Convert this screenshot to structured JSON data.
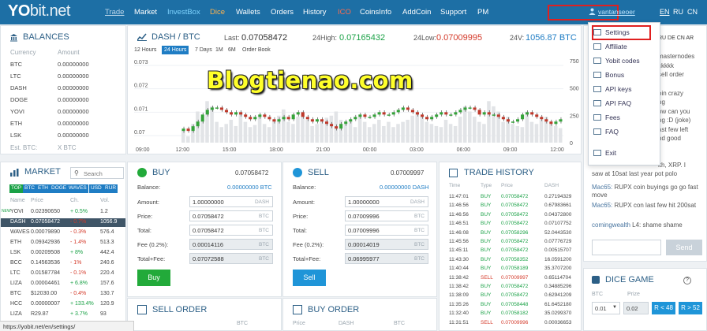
{
  "header": {
    "logo_main": "YO",
    "logo_rest": "bit.net",
    "nav": [
      "Trade",
      "Market",
      "InvestBox",
      "Dice",
      "Wallets",
      "Orders",
      "History",
      "ICO",
      "CoinsInfo",
      "AddCoin",
      "Support",
      "PM"
    ],
    "username": "vantanseoer",
    "langs": [
      "EN",
      "RU",
      "CN"
    ]
  },
  "balances": {
    "title": "BALANCES",
    "col_currency": "Currency",
    "col_amount": "Amount",
    "rows": [
      {
        "c": "BTC",
        "a": "0.00000000"
      },
      {
        "c": "LTC",
        "a": "0.00000000"
      },
      {
        "c": "DASH",
        "a": "0.00000000"
      },
      {
        "c": "DOGE",
        "a": "0.00000000"
      },
      {
        "c": "YOVI",
        "a": "0.00000000"
      },
      {
        "c": "ETH",
        "a": "0.00000000"
      },
      {
        "c": "LSK",
        "a": "0.00000000"
      }
    ],
    "est_label": "Est. BTC:",
    "est_value": "X BTC"
  },
  "market": {
    "title": "MARKET",
    "search_placeholder": "Search",
    "tabs": [
      "TOP",
      "BTC",
      "ETH",
      "DOGE",
      "WAVES",
      "USD",
      "RUR"
    ],
    "cols": [
      "Name",
      "Price",
      "Ch.",
      "Vol."
    ],
    "rows": [
      {
        "n": "YOVI",
        "p": "0.02390650",
        "ch": "+ 0.5%",
        "v": "1.2",
        "up": true
      },
      {
        "n": "DASH",
        "p": "0.07058472",
        "ch": "- 0.7%",
        "v": "1056.9",
        "up": false
      },
      {
        "n": "WAVES",
        "p": "0.00079890",
        "ch": "- 0.3%",
        "v": "576.4",
        "up": false
      },
      {
        "n": "ETH",
        "p": "0.09342936",
        "ch": "- 1.4%",
        "v": "513.3",
        "up": false
      },
      {
        "n": "LSK",
        "p": "0.00209508",
        "ch": "+ 8%",
        "v": "442.4",
        "up": true
      },
      {
        "n": "BCC",
        "p": "0.14563536",
        "ch": "- 1%",
        "v": "240.6",
        "up": false
      },
      {
        "n": "LTC",
        "p": "0.01587784",
        "ch": "- 0.1%",
        "v": "220.4",
        "up": false
      },
      {
        "n": "LIZA",
        "p": "0.00004461",
        "ch": "+ 6.8%",
        "v": "157.6",
        "up": true
      },
      {
        "n": "BTC",
        "p": "$12030.00",
        "ch": "- 0.4%",
        "v": "130.7",
        "up": false
      },
      {
        "n": "HCC",
        "p": "0.00000007",
        "ch": "+ 133.4%",
        "v": "120.9",
        "up": true
      },
      {
        "n": "LIZA",
        "p": "R29.87",
        "ch": "+ 3.7%",
        "v": "93",
        "up": true
      }
    ]
  },
  "chart": {
    "pair": "DASH / BTC",
    "last_label": "Last:",
    "last": "0.07058472",
    "high_label": "24High:",
    "high": "0.07165432",
    "low_label": "24Low:",
    "low": "0.07009995",
    "vol_label": "24V:",
    "vol": "1056.87 BTC",
    "ranges": [
      "12 Hours",
      "24 Hours",
      "7 Days",
      "1M",
      "6M",
      "Order Book"
    ],
    "active_range": "24 Hours"
  },
  "chart_data": {
    "type": "candlestick",
    "yticks": [
      "0.073",
      "0.072",
      "0.071",
      "0.07"
    ],
    "vol_ticks": [
      "750",
      "500",
      "250",
      "0"
    ],
    "xticks": [
      "09:00",
      "12:00",
      "15:00",
      "18:00",
      "21:00",
      "00:00",
      "03:00",
      "06:00",
      "09:00",
      "12:00"
    ],
    "ylim": [
      0.0697,
      0.0732
    ],
    "close": [
      0.0703,
      0.0702,
      0.0704,
      0.0706,
      0.0709,
      0.0711,
      0.0712,
      0.0712,
      0.0711,
      0.071,
      0.0709,
      0.071,
      0.0709,
      0.0708,
      0.0707,
      0.0708,
      0.0709,
      0.0708,
      0.0707,
      0.0706,
      0.0707,
      0.0708,
      0.0707,
      0.0709,
      0.071,
      0.0708,
      0.0707,
      0.0706,
      0.0707,
      0.0706,
      0.0705,
      0.0704,
      0.0703,
      0.0705,
      0.0706,
      0.0707,
      0.0708,
      0.0709,
      0.0708,
      0.0708,
      0.0709,
      0.071,
      0.0709,
      0.0709,
      0.071,
      0.0711,
      0.0712,
      0.0711,
      0.071,
      0.0709,
      0.0708,
      0.0707,
      0.0708,
      0.0709,
      0.071,
      0.0709,
      0.0709,
      0.071,
      0.0711,
      0.0712,
      0.0712,
      0.0711,
      0.0709,
      0.071,
      0.0709,
      0.0709,
      0.0708,
      0.0707,
      0.0706,
      0.0706,
      0.0707,
      0.0709,
      0.071,
      0.0709,
      0.0708,
      0.0707,
      0.0706,
      0.0705,
      0.0706,
      0.0707
    ],
    "volume": [
      120,
      60,
      180,
      300,
      250,
      400,
      350,
      200,
      150,
      180,
      220,
      160,
      300,
      200,
      150,
      170,
      260,
      180,
      150,
      220,
      260,
      320,
      200,
      180,
      250,
      300,
      220,
      160,
      180,
      220,
      240,
      260,
      300,
      220,
      180,
      200,
      150,
      250,
      200,
      150,
      180,
      220,
      160,
      200,
      150,
      180,
      200,
      220,
      260,
      300,
      250,
      200,
      180,
      160,
      150,
      220,
      180,
      160,
      250,
      350,
      300,
      250,
      200,
      180,
      400,
      350,
      300,
      200,
      250,
      180,
      160,
      150,
      300,
      200,
      180,
      220,
      250,
      180,
      160,
      140
    ]
  },
  "buy": {
    "title": "BUY",
    "top_price": "0.07058472",
    "balance_label": "Balance:",
    "balance": "0.00000000 BTC",
    "amount_label": "Amount:",
    "amount": "1.00000000",
    "amount_unit": "DASH",
    "price_label": "Price:",
    "price": "0.07058472",
    "price_unit": "BTC",
    "total_label": "Total:",
    "total": "0.07058472",
    "total_unit": "BTC",
    "fee_label": "Fee (0.2%):",
    "fee": "0.00014116",
    "fee_unit": "BTC",
    "totalfee_label": "Total+Fee:",
    "totalfee": "0.07072588",
    "totalfee_unit": "BTC",
    "button": "Buy"
  },
  "sell": {
    "title": "SELL",
    "top_price": "0.07009997",
    "balance_label": "Balance:",
    "balance": "0.00000000 DASH",
    "amount_label": "Amount:",
    "amount": "1.00000000",
    "amount_unit": "DASH",
    "price_label": "Price:",
    "price": "0.07009996",
    "price_unit": "BTC",
    "total_label": "Total:",
    "total": "0.07009996",
    "total_unit": "BTC",
    "fee_label": "Fee (0.2%):",
    "fee": "0.00014019",
    "fee_unit": "BTC",
    "totalfee_label": "Total+Fee:",
    "totalfee": "0.06995977",
    "totalfee_unit": "BTC",
    "button": "Sell"
  },
  "sell_order": {
    "title": "SELL ORDER",
    "c3": "BTC"
  },
  "buy_order": {
    "title": "BUY ORDER",
    "c1": "Price",
    "c2": "DASH",
    "c3": "BTC"
  },
  "trade_history": {
    "title": "TRADE HISTORY",
    "cols": [
      "Time",
      "Type",
      "Price",
      "DASH"
    ],
    "rows": [
      {
        "t": "11:47:01",
        "ty": "BUY",
        "p": "0.07058472",
        "a": "0.27194329"
      },
      {
        "t": "11:46:56",
        "ty": "BUY",
        "p": "0.07058472",
        "a": "0.67983661"
      },
      {
        "t": "11:46:56",
        "ty": "BUY",
        "p": "0.07058472",
        "a": "0.04372800"
      },
      {
        "t": "11:46:51",
        "ty": "BUY",
        "p": "0.07058472",
        "a": "0.07107752"
      },
      {
        "t": "11:46:08",
        "ty": "BUY",
        "p": "0.07058296",
        "a": "52.0443530"
      },
      {
        "t": "11:45:56",
        "ty": "BUY",
        "p": "0.07058472",
        "a": "0.07776729"
      },
      {
        "t": "11:45:11",
        "ty": "BUY",
        "p": "0.07058472",
        "a": "0.00515707"
      },
      {
        "t": "11:43:30",
        "ty": "BUY",
        "p": "0.07058352",
        "a": "16.0591200"
      },
      {
        "t": "11:40:44",
        "ty": "BUY",
        "p": "0.07058189",
        "a": "35.3707200"
      },
      {
        "t": "11:38:42",
        "ty": "SELL",
        "p": "0.07009997",
        "a": "0.65114704"
      },
      {
        "t": "11:38:42",
        "ty": "BUY",
        "p": "0.07058472",
        "a": "0.34885296"
      },
      {
        "t": "11:38:09",
        "ty": "BUY",
        "p": "0.07058472",
        "a": "0.62941209"
      },
      {
        "t": "11:35:26",
        "ty": "BUY",
        "p": "0.07058448",
        "a": "61.6452180"
      },
      {
        "t": "11:32:40",
        "ty": "BUY",
        "p": "0.07058182",
        "a": "35.0299370"
      },
      {
        "t": "11:31:51",
        "ty": "SELL",
        "p": "0.07009996",
        "a": "0.00036653"
      }
    ]
  },
  "dropdown": {
    "items": [
      "Settings",
      "Affiliate",
      "Yobit codes",
      "Bonus",
      "API keys",
      "API FAQ",
      "Fees",
      "FAQ",
      "Exit"
    ]
  },
  "chat": {
    "langs": "RU DE CN AR",
    "fragments": [
      "masternodes",
      "ckkkk",
      "sell order",
      "oin crazy",
      "ng",
      "ow can you",
      "ng :D (joke)",
      "ast few left",
      "nd good",
      "ith, XRP. I"
    ],
    "lines": [
      {
        "user": "",
        "msg": "saw at 10sat last year pot polo"
      },
      {
        "user": "Mac65:",
        "msg": "RUPX coin buyings go go fast move"
      },
      {
        "user": "Mac65:",
        "msg": "RUPX con last few hit 200sat"
      },
      {
        "user": "comingwealth",
        "msg": "L4: shame shame"
      }
    ],
    "send": "Send"
  },
  "dice": {
    "title": "DICE GAME",
    "btc_label": "BTC",
    "prize_label": "Prize",
    "bet": "0.01",
    "prize": "0.02",
    "lt": "R < 48",
    "gt": "R > 52"
  },
  "watermark": "Blogtienao.com",
  "status_url": "https://yobit.net/en/settings/"
}
